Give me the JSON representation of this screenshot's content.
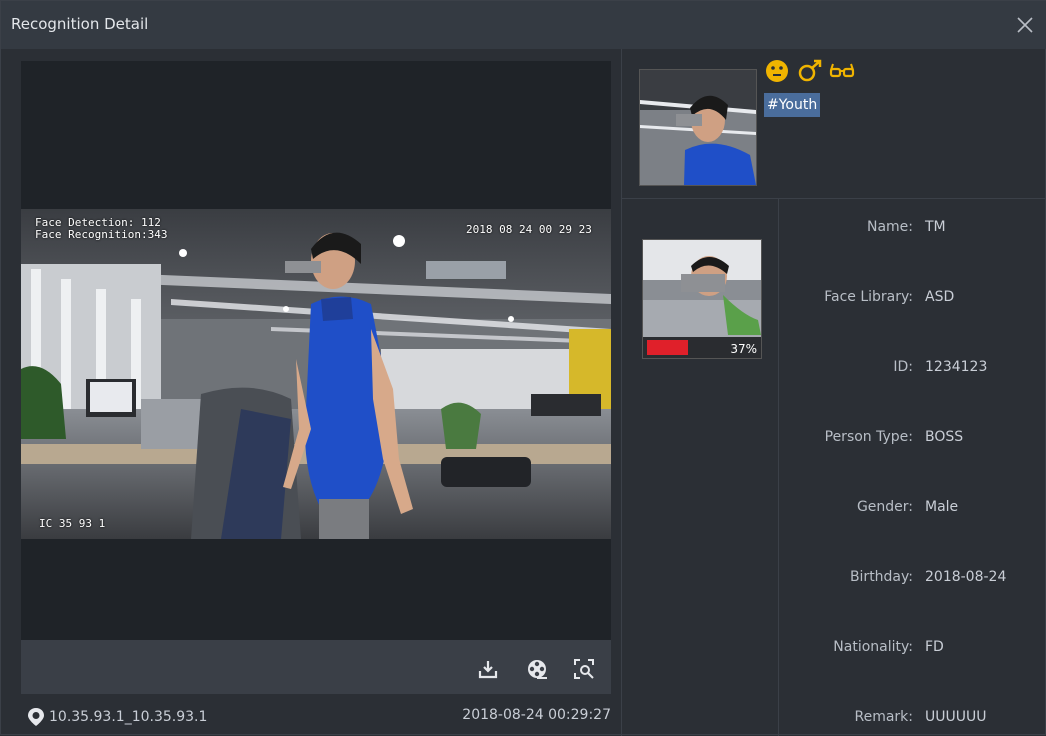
{
  "window": {
    "title": "Recognition Detail"
  },
  "video": {
    "osd_face_detection": "Face Detection: 112",
    "osd_face_recognition": "Face Recognition:343",
    "osd_timestamp": "2018 08 24 00 29 23",
    "osd_channel": "IC 35 93 1"
  },
  "footer": {
    "location": "10.35.93.1_10.35.93.1",
    "timestamp": "2018-08-24 00:29:27"
  },
  "toolbar": {
    "icons": [
      "download-icon",
      "film-reel-icon",
      "face-search-icon"
    ]
  },
  "snapshot": {
    "attribute_icons": [
      "expression-icon",
      "male-gender-icon",
      "glasses-icon"
    ],
    "age_tag": "#Youth"
  },
  "match": {
    "similarity": "37%",
    "similarity_value": 0.37
  },
  "info": [
    {
      "label": "Name:",
      "value": "TM"
    },
    {
      "label": "Face Library:",
      "value": "ASD"
    },
    {
      "label": "ID:",
      "value": "1234123"
    },
    {
      "label": "Person Type:",
      "value": "BOSS"
    },
    {
      "label": "Gender:",
      "value": "Male"
    },
    {
      "label": "Birthday:",
      "value": "2018-08-24"
    },
    {
      "label": "Nationality:",
      "value": "FD"
    },
    {
      "label": "Remark:",
      "value": "UUUUUU"
    }
  ],
  "colors": {
    "accent_yellow": "#f0b400",
    "tag_bg": "#4a6d9c",
    "similarity_bar": "#e0202a",
    "shirt_blue": "#1f4fc8"
  }
}
